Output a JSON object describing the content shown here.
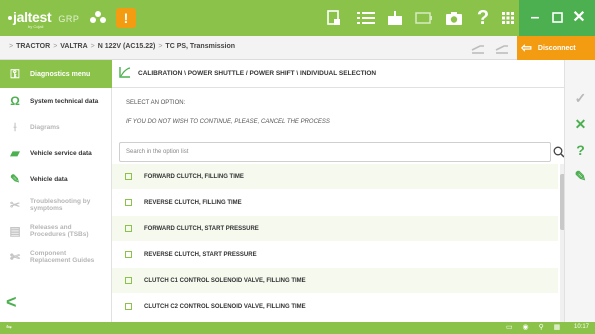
{
  "app": {
    "logo": "jaltest",
    "logo_group": "GRP",
    "logo_sub": "by Cojali",
    "alert_badge": "!"
  },
  "breadcrumb": {
    "items": [
      "TRACTOR",
      "VALTRA",
      "N 122V (AC15.22)",
      "TC PS, Transmission"
    ],
    "separator": ">"
  },
  "disconnect_label": "Disconnect",
  "sidebar": {
    "active_label": "Diagnostics menu",
    "items": [
      {
        "label": "System technical data",
        "icon": "omega-icon"
      },
      {
        "label": "Diagrams",
        "icon": "diagram-icon"
      },
      {
        "label": "Vehicle service data",
        "icon": "oil-can-icon"
      },
      {
        "label": "Vehicle data",
        "icon": "wrench-icon"
      },
      {
        "label": "Troubleshooting by symptoms",
        "icon": "tools-icon"
      },
      {
        "label": "Releases and Procedures (TSBs)",
        "icon": "document-icon"
      },
      {
        "label": "Component Replacement Guides",
        "icon": "replace-icon"
      }
    ],
    "back_label": "<"
  },
  "content": {
    "path_title": "CALIBRATION \\ POWER SHUTTLE / POWER SHIFT \\ INDIVIDUAL SELECTION",
    "prompt": "SELECT AN OPTION:",
    "prompt_note": "IF YOU DO NOT WISH TO CONTINUE, PLEASE, CANCEL THE PROCESS",
    "search_placeholder": "Search in the option list",
    "options": [
      "FORWARD CLUTCH, FILLING TIME",
      "REVERSE CLUTCH, FILLING TIME",
      "FORWARD CLUTCH, START PRESSURE",
      "REVERSE CLUTCH, START PRESSURE",
      "CLUTCH C1 CONTROL SOLENOID VALVE, FILLING TIME",
      "CLUTCH C2 CONTROL SOLENOID VALVE, FILLING TIME"
    ]
  },
  "right_actions": [
    {
      "name": "confirm",
      "glyph": "✓",
      "color": "#b9b9b9"
    },
    {
      "name": "cancel",
      "glyph": "✕",
      "color": "#4caf50"
    },
    {
      "name": "help",
      "glyph": "?",
      "color": "#4caf50"
    },
    {
      "name": "report",
      "glyph": "✎",
      "color": "#4caf50"
    }
  ],
  "status": {
    "time": "10:17"
  },
  "colors": {
    "brand_green": "#8bc34a",
    "dark_green": "#4caf50",
    "orange": "#f39c12"
  }
}
